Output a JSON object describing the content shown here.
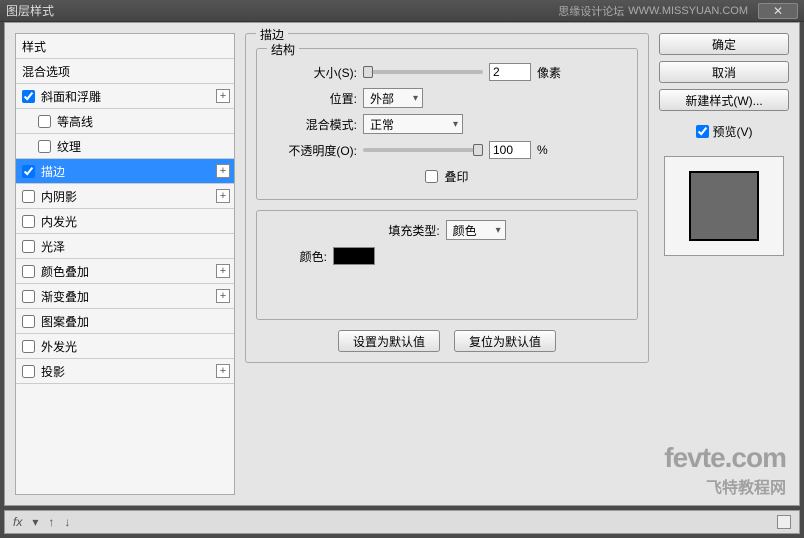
{
  "titlebar": {
    "title": "图层样式",
    "forum": "思缘设计论坛",
    "url": "WWW.MISSYUAN.COM"
  },
  "styles": {
    "header": "样式",
    "blending": "混合选项",
    "items": [
      {
        "label": "斜面和浮雕",
        "checked": true,
        "expand": true
      },
      {
        "label": "等高线",
        "checked": false,
        "sub": true
      },
      {
        "label": "纹理",
        "checked": false,
        "sub": true
      },
      {
        "label": "描边",
        "checked": true,
        "selected": true,
        "expand": true
      },
      {
        "label": "内阴影",
        "checked": false,
        "expand": true
      },
      {
        "label": "内发光",
        "checked": false
      },
      {
        "label": "光泽",
        "checked": false
      },
      {
        "label": "颜色叠加",
        "checked": false,
        "expand": true
      },
      {
        "label": "渐变叠加",
        "checked": false,
        "expand": true
      },
      {
        "label": "图案叠加",
        "checked": false
      },
      {
        "label": "外发光",
        "checked": false
      },
      {
        "label": "投影",
        "checked": false,
        "expand": true
      }
    ]
  },
  "stroke": {
    "title": "描边",
    "structure": "结构",
    "size_label": "大小(S):",
    "size_value": "2",
    "size_unit": "像素",
    "position_label": "位置:",
    "position_value": "外部",
    "blend_label": "混合模式:",
    "blend_value": "正常",
    "opacity_label": "不透明度(O):",
    "opacity_value": "100",
    "opacity_unit": "%",
    "overprint": "叠印",
    "filltype_label": "填充类型:",
    "filltype_value": "颜色",
    "color_label": "颜色:",
    "set_default": "设置为默认值",
    "reset_default": "复位为默认值"
  },
  "buttons": {
    "ok": "确定",
    "cancel": "取消",
    "new_style": "新建样式(W)...",
    "preview": "预览(V)"
  },
  "footer": {
    "fx": "fx"
  },
  "watermark": {
    "big": "fevte.com",
    "small": "飞特教程网"
  }
}
